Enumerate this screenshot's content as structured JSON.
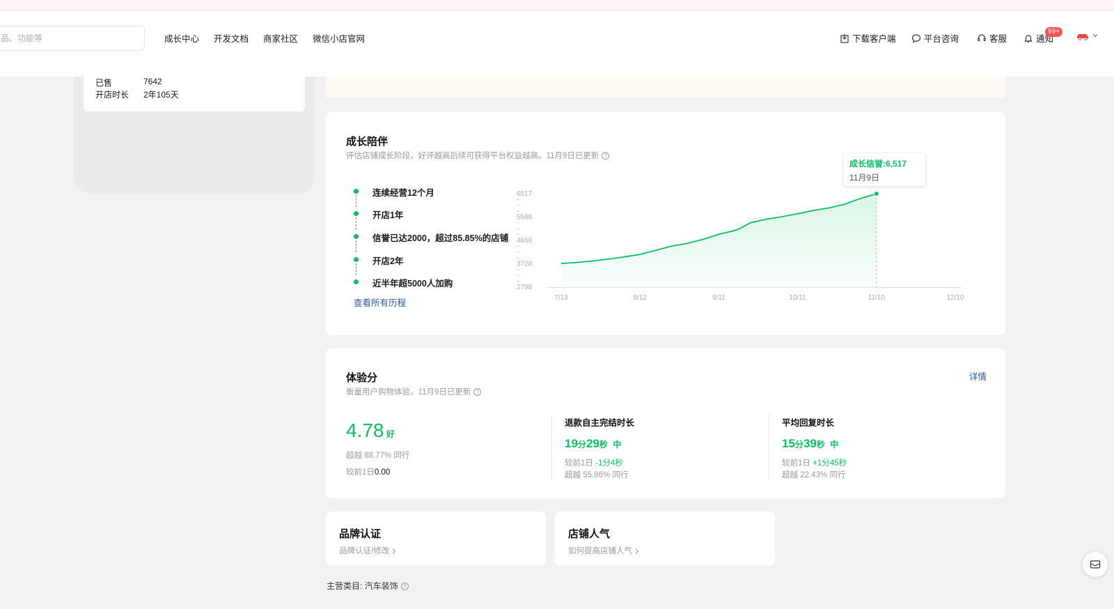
{
  "header": {
    "search_placeholder": "品、功能等",
    "nav": [
      "成长中心",
      "开发文档",
      "商家社区",
      "微信小店官网"
    ],
    "right": {
      "download": "下载客户端",
      "consult": "平台咨询",
      "service": "客服",
      "notify": "通知",
      "notify_badge": "99+"
    }
  },
  "shop_info": {
    "sold_label": "已售",
    "sold_value": "7642",
    "age_label": "开店时长",
    "age_value": "2年105天"
  },
  "growth": {
    "title": "成长陪伴",
    "subtitle": "评估店铺成长阶段，好评越高后续可获得平台权益越高。11月9日已更新",
    "milestones": [
      "连续经营12个月",
      "开店1年",
      "信誉已达2000，超过85.85%的店铺",
      "开店2年",
      "近半年超5000人加购"
    ],
    "view_all": "查看所有历程",
    "tooltip": {
      "label": "成长信誉:6,517",
      "date": "11月9日"
    }
  },
  "chart_data": {
    "type": "area",
    "x_ticks": [
      "7/13",
      "8/12",
      "9/11",
      "10/11",
      "11/10",
      "12/10"
    ],
    "y_ticks": [
      "6517",
      "5588",
      "4658",
      "3728",
      "2798"
    ],
    "ylim": [
      2798,
      6517
    ],
    "series": [
      {
        "x_days": [
          0,
          10,
          20,
          30,
          40,
          50,
          60,
          70,
          80,
          90,
          100,
          110,
          113,
          120,
          130,
          140,
          150,
          160,
          170,
          180,
          190,
          200
        ],
        "values": [
          3740,
          3780,
          3840,
          3910,
          4000,
          4100,
          4260,
          4430,
          4540,
          4700,
          4900,
          5050,
          5120,
          5360,
          5500,
          5600,
          5720,
          5850,
          5950,
          6100,
          6330,
          6517
        ]
      }
    ],
    "colors": {
      "line": "#07c160",
      "fill": "#d9f5e6"
    }
  },
  "experience": {
    "title": "体验分",
    "subtitle": "衡量用户购物体验，11月9日已更新",
    "details": "详情",
    "score": "4.78",
    "score_grade": "好",
    "exceed": "超越 88.77% 同行",
    "prev_label": "较前1日",
    "prev_value": "0.00",
    "refund": {
      "title": "退款自主完结时长",
      "min": "19",
      "min_unit": "分",
      "sec": "29",
      "sec_unit": "秒",
      "grade": "中",
      "prev_label": "较前1日",
      "prev_value": "-1分4秒",
      "exceed": "超越 55.86% 同行"
    },
    "reply": {
      "title": "平均回复时长",
      "min": "15",
      "min_unit": "分",
      "sec": "39",
      "sec_unit": "秒",
      "grade": "中",
      "prev_label": "较前1日",
      "prev_value": "+1分45秒",
      "exceed": "超越 22.43% 同行"
    }
  },
  "brand": {
    "title": "品牌认证",
    "link": "品牌认证/修改"
  },
  "popularity": {
    "title": "店铺人气",
    "link": "如何提高店铺人气"
  },
  "category": {
    "label": "主营类目:",
    "value": "汽车装饰"
  }
}
